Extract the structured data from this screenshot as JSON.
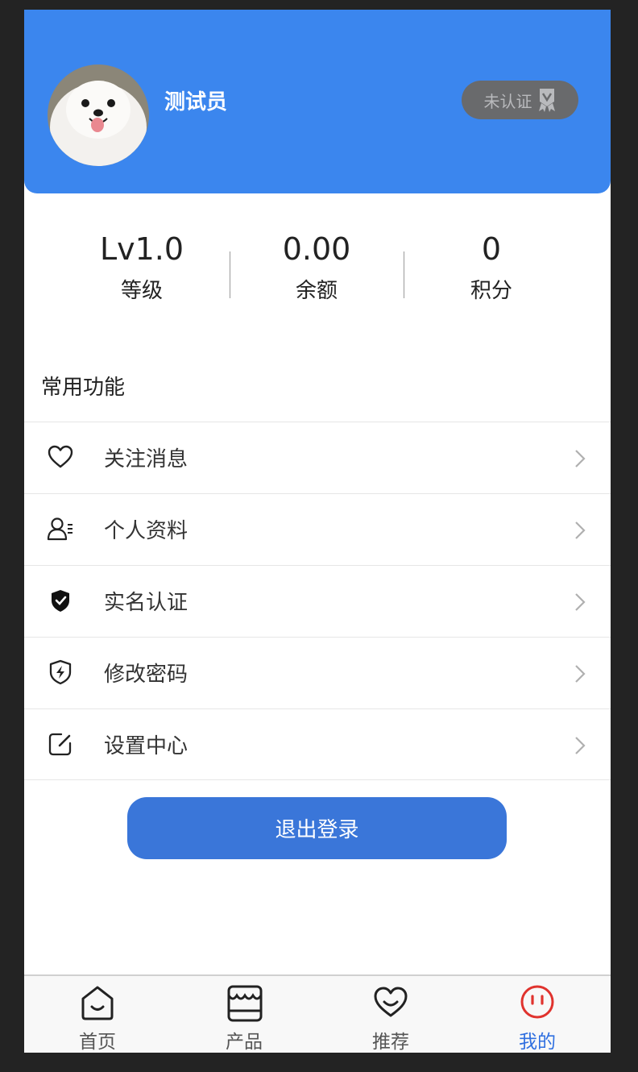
{
  "profile": {
    "username": "测试员",
    "auth_badge": "未认证"
  },
  "stats": [
    {
      "value": "Lv1.0",
      "label": "等级"
    },
    {
      "value": "0.00",
      "label": "余额"
    },
    {
      "value": "0",
      "label": "积分"
    }
  ],
  "section_title": "常用功能",
  "menu": [
    {
      "label": "关注消息",
      "icon": "heart-icon"
    },
    {
      "label": "个人资料",
      "icon": "profile-icon"
    },
    {
      "label": "实名认证",
      "icon": "shield-check-icon"
    },
    {
      "label": "修改密码",
      "icon": "shield-bolt-icon"
    },
    {
      "label": "设置中心",
      "icon": "edit-icon"
    }
  ],
  "logout_label": "退出登录",
  "tabs": [
    {
      "label": "首页",
      "icon": "home-icon"
    },
    {
      "label": "产品",
      "icon": "store-icon"
    },
    {
      "label": "推荐",
      "icon": "heart-icon"
    },
    {
      "label": "我的",
      "icon": "face-icon",
      "active": true
    }
  ],
  "colors": {
    "header": "#3b86ee",
    "button": "#3a76d9",
    "active_tab": "#2f6fe0",
    "active_tab_icon": "#e0332e"
  }
}
